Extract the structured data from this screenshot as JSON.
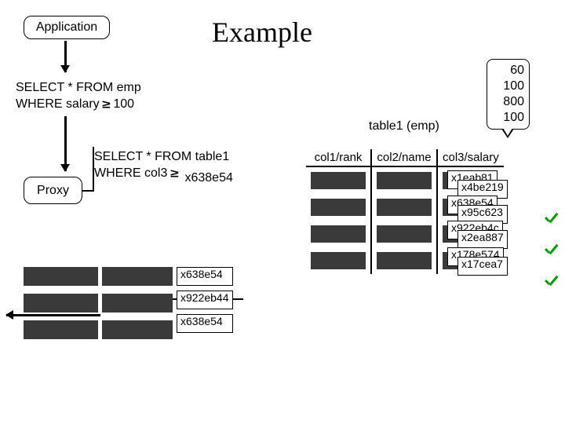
{
  "title": "Example",
  "boxes": {
    "application": "Application",
    "proxy": "Proxy"
  },
  "query1": {
    "line1": "SELECT * FROM emp",
    "line2a": "WHERE salary ",
    "line2b": " 100"
  },
  "query2": {
    "line1": "SELECT * FROM table1",
    "line2a": "WHERE col3 ",
    "line2c": "x638e54"
  },
  "tablelabel": "table1 (emp)",
  "callout": [
    "60",
    "100",
    "800",
    "100"
  ],
  "headers": [
    "col1/rank",
    "col2/name",
    "col3/salary"
  ],
  "rows": [
    {
      "shown": "x1eab81",
      "extra": "x4be219"
    },
    {
      "shown": "x638e54",
      "extra": "x95c623"
    },
    {
      "shown": "x922eb4c",
      "extra": "x2ea887"
    },
    {
      "shown": "x178e574",
      "extra": "x17cea7"
    }
  ],
  "result": [
    "x638e54",
    "x922eb44",
    "x638e54"
  ]
}
